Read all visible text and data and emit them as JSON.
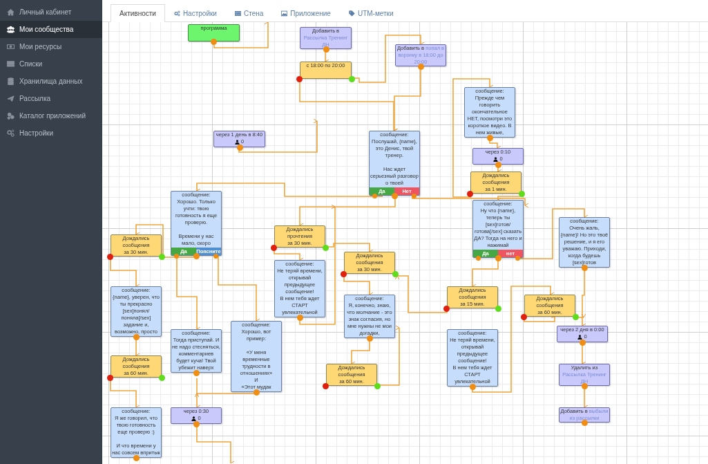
{
  "sidebar": {
    "items": [
      {
        "label": "Личный кабинет",
        "selected": false
      },
      {
        "label": "Мои сообщества",
        "selected": true
      },
      {
        "label": "Мои ресурсы",
        "selected": false
      },
      {
        "label": "Списки",
        "selected": false
      },
      {
        "label": "Хранилища данных",
        "selected": false
      },
      {
        "label": "Рассылка",
        "selected": false
      },
      {
        "label": "Каталог приложений",
        "selected": false
      },
      {
        "label": "Настройки",
        "selected": false
      }
    ]
  },
  "tabs": [
    {
      "label": "Активности",
      "selected": true
    },
    {
      "label": "Настройки",
      "selected": false
    },
    {
      "label": "Стена",
      "selected": false
    },
    {
      "label": "Приложение",
      "selected": false
    },
    {
      "label": "UTM-метки",
      "selected": false
    }
  ],
  "nodes": [
    {
      "kind": "action",
      "text": "программа"
    },
    {
      "kind": "add",
      "text": "Добавить в",
      "link": "Рассылка Тренинг ДН"
    },
    {
      "kind": "condition",
      "text": "с 18:00 по 20:00"
    },
    {
      "kind": "add",
      "text": "Добавить в",
      "link": "попал в воронку в 18:00 до 20:00"
    },
    {
      "kind": "delay",
      "text": "через 1 день в 8:40",
      "count": "0"
    },
    {
      "kind": "message",
      "header": "сообщение:",
      "text": "Послушай, {name}, это Денис, твой тренер.\n\nНас ждет серьезный разговор о твоей",
      "buttons": [
        {
          "label": "Да",
          "kind": "yes"
        },
        {
          "label": "Нет",
          "kind": "no"
        }
      ]
    },
    {
      "kind": "message",
      "header": "сообщение:",
      "text": "Прежде чем говорить окончательное НЕТ, посмотри это короткое видео. В нем живые,"
    },
    {
      "kind": "delay",
      "text": "через 0:10",
      "count": "0"
    },
    {
      "kind": "wait",
      "text": "Дождались\nсообщения\nза 1 мин."
    },
    {
      "kind": "wait",
      "text": "Дождались\nсообщения\nза 30 мин."
    },
    {
      "kind": "message",
      "header": "сообщение:",
      "text": "Хорошо. Только учти: твою готовность я еще проверю.\n\nВремени у нас мало, скоро",
      "buttons": [
        {
          "label": "Да",
          "kind": "yes"
        },
        {
          "label": "Поясните",
          "kind": "info"
        }
      ]
    },
    {
      "kind": "wait",
      "text": "Дождались\nпрочтения\nза 30 мин."
    },
    {
      "kind": "message",
      "header": "сообщение:",
      "text": "Ну что {name}, теперь ты [sex]готов/ готова[/sex] сказать ДА? Тогда на него и нажимай",
      "buttons": [
        {
          "label": "Да",
          "kind": "yes"
        },
        {
          "label": "нет",
          "kind": "no"
        }
      ]
    },
    {
      "kind": "message",
      "header": "сообщение:",
      "text": "Очень жаль, {name}! Но это твоё решение, и я его уважаю. Приходи, когда будешь [sex]готов"
    },
    {
      "kind": "message",
      "header": "сообщение:",
      "text": "{name}, уверен, что ты прекрасно [sex]понял/ поняла[/sex] задание и, возможно, просто"
    },
    {
      "kind": "message",
      "header": "сообщение:",
      "text": "Не теряй времени, открывай предыдущее сообщение!\nВ нем тебя ждет СТАРТ увлекательной"
    },
    {
      "kind": "wait",
      "text": "Дождались\nсообщения\nза 30 мин."
    },
    {
      "kind": "message",
      "header": "сообщение:",
      "text": "Я, конечно, знаю, что молчание - это знак согласия, но мне нужны не мои догадки,"
    },
    {
      "kind": "wait",
      "text": "Дождались\nсообщения\nза 15 мин."
    },
    {
      "kind": "wait",
      "text": "Дождались\nсообщения\nза 60 мин."
    },
    {
      "kind": "message",
      "header": "сообщение:",
      "text": "Тогда приступай. И не надо стесняться, комментариев будет куча! Твой убежит наверх"
    },
    {
      "kind": "message",
      "header": "сообщение:",
      "text": "Хорошо, вот пример:\n\n«У меня временные трудности в отношениях»\nИ\n«Этот мудак"
    },
    {
      "kind": "message",
      "header": "сообщение:",
      "text": "Не теряй времени, открывай предыдущее сообщение!\nВ нем тебя ждет СТАРТ увлекательной"
    },
    {
      "kind": "delay",
      "text": "через 2 дня в 0:00",
      "count": "0"
    },
    {
      "kind": "wait",
      "text": "Дождались\nсообщения\nза 60 мин."
    },
    {
      "kind": "wait",
      "text": "Дождались\nсообщения\nза 60 мин."
    },
    {
      "kind": "remove",
      "text": "Удалить из",
      "link": "Рассылка Тренинг ДН"
    },
    {
      "kind": "message",
      "header": "сообщение:",
      "text": "Я же говорил, что твою готовность еще проверю :)\n\nИ что времени у нас совсем впритык"
    },
    {
      "kind": "delay",
      "text": "через 0:30",
      "count": "0"
    },
    {
      "kind": "add",
      "text": "Добавить в",
      "link": "выбыли из рассылки"
    }
  ]
}
